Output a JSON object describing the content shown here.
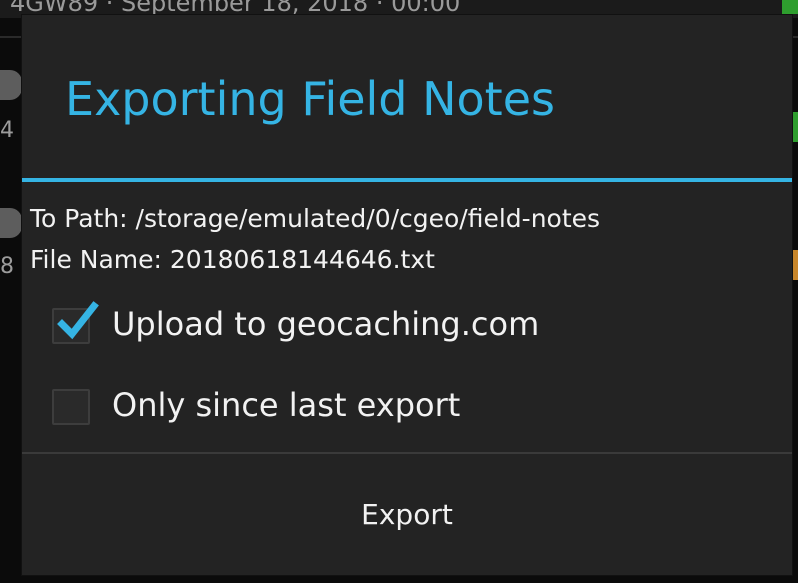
{
  "background": {
    "topbar_text": "4GW89 · September 18, 2018 · 00:00",
    "row_numbers": [
      "4",
      "8"
    ]
  },
  "dialog": {
    "title": "Exporting Field Notes",
    "path_line": "To Path: /storage/emulated/0/cgeo/field-notes",
    "filename_line": "File Name: 20180618144646.txt",
    "options": [
      {
        "label": "Upload to geocaching.com",
        "checked": true
      },
      {
        "label": "Only since last export",
        "checked": false
      }
    ],
    "export_label": "Export"
  },
  "colors": {
    "accent": "#35b4e4",
    "dialog_bg": "#232323",
    "text": "#f2f2f2"
  },
  "icons": {
    "checked": "checkmark-icon"
  }
}
